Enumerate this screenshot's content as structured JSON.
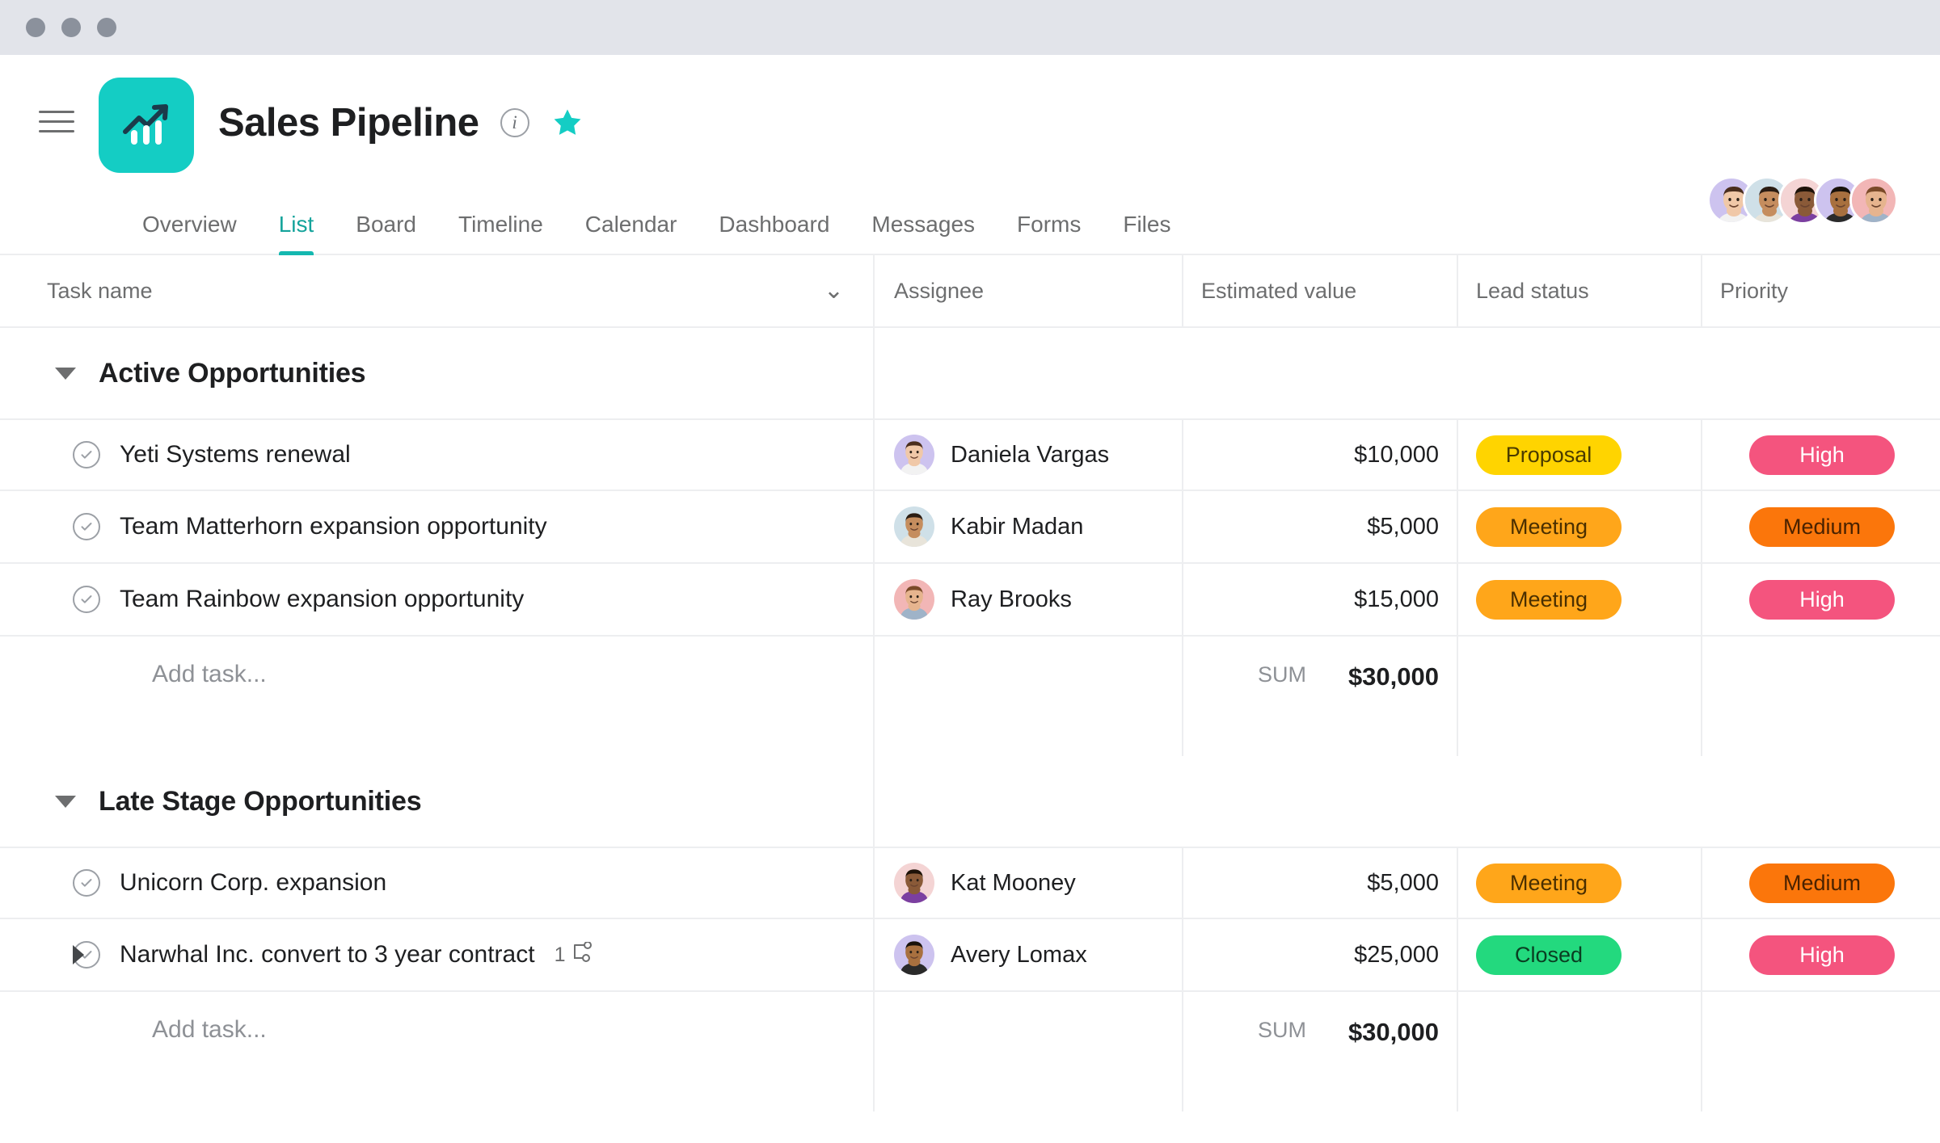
{
  "window": {
    "dots": [
      "close",
      "minimize",
      "maximize"
    ]
  },
  "header": {
    "menu_icon": "hamburger-icon",
    "logo_icon": "chart-growth-icon",
    "logo_color": "#14cdc4",
    "title": "Sales Pipeline",
    "info_icon": "info-icon",
    "star_icon": "star-icon",
    "star_color": "#14cdc4",
    "members": [
      {
        "name": "Daniela Vargas",
        "bg": "#cdc3ef",
        "skin": "#f0c8a8",
        "hair": "#4a2e1e",
        "top": "#f2f2f2"
      },
      {
        "name": "Kabir Madan",
        "bg": "#cfe0e8",
        "skin": "#c58d5e",
        "hair": "#2b1d13",
        "top": "#e8e4da"
      },
      {
        "name": "Kat Mooney",
        "bg": "#f4d4d4",
        "skin": "#8a5a38",
        "hair": "#1d1208",
        "top": "#7b3fa0"
      },
      {
        "name": "Avery Lomax",
        "bg": "#cdc3ef",
        "skin": "#a8703f",
        "hair": "#19120b",
        "top": "#2a2a2a"
      },
      {
        "name": "Ray Brooks",
        "bg": "#f2b6b6",
        "skin": "#e6b48e",
        "hair": "#7a4a28",
        "top": "#9fb3c8"
      }
    ]
  },
  "tabs": [
    {
      "label": "Overview",
      "active": false
    },
    {
      "label": "List",
      "active": true
    },
    {
      "label": "Board",
      "active": false
    },
    {
      "label": "Timeline",
      "active": false
    },
    {
      "label": "Calendar",
      "active": false
    },
    {
      "label": "Dashboard",
      "active": false
    },
    {
      "label": "Messages",
      "active": false
    },
    {
      "label": "Forms",
      "active": false
    },
    {
      "label": "Files",
      "active": false
    }
  ],
  "table": {
    "columns": {
      "task_name": "Task name",
      "assignee": "Assignee",
      "estimated_value": "Estimated value",
      "lead_status": "Lead status",
      "priority": "Priority"
    },
    "sum_label": "SUM",
    "add_task_label": "Add task...",
    "sections": [
      {
        "title": "Active Opportunities",
        "expanded": true,
        "sum": "$30,000",
        "tasks": [
          {
            "name": "Yeti Systems renewal",
            "assignee": "Daniela Vargas",
            "avatar": {
              "bg": "#cdc3ef",
              "skin": "#f0c8a8",
              "hair": "#4a2e1e",
              "top": "#f2f2f2"
            },
            "value": "$10,000",
            "status": {
              "label": "Proposal",
              "bg": "#ffd400",
              "fg": "#4a3b00"
            },
            "priority": {
              "label": "High",
              "bg": "#f4547e",
              "fg": "#ffffff"
            },
            "has_subtasks": false,
            "subtask_count": null
          },
          {
            "name": "Team Matterhorn expansion opportunity",
            "assignee": "Kabir Madan",
            "avatar": {
              "bg": "#cfe0e8",
              "skin": "#c58d5e",
              "hair": "#2b1d13",
              "top": "#e8e4da"
            },
            "value": "$5,000",
            "status": {
              "label": "Meeting",
              "bg": "#ffa61a",
              "fg": "#4a2f00"
            },
            "priority": {
              "label": "Medium",
              "bg": "#fb760b",
              "fg": "#4a2200"
            },
            "has_subtasks": false,
            "subtask_count": null
          },
          {
            "name": "Team Rainbow expansion opportunity",
            "assignee": "Ray Brooks",
            "avatar": {
              "bg": "#f2b6b6",
              "skin": "#e6b48e",
              "hair": "#7a4a28",
              "top": "#9fb3c8"
            },
            "value": "$15,000",
            "status": {
              "label": "Meeting",
              "bg": "#ffa61a",
              "fg": "#4a2f00"
            },
            "priority": {
              "label": "High",
              "bg": "#f4547e",
              "fg": "#ffffff"
            },
            "has_subtasks": false,
            "subtask_count": null
          }
        ]
      },
      {
        "title": "Late Stage Opportunities",
        "expanded": true,
        "sum": "$30,000",
        "tasks": [
          {
            "name": "Unicorn Corp. expansion",
            "assignee": "Kat Mooney",
            "avatar": {
              "bg": "#f4d4d4",
              "skin": "#8a5a38",
              "hair": "#1d1208",
              "top": "#7b3fa0"
            },
            "value": "$5,000",
            "status": {
              "label": "Meeting",
              "bg": "#ffa61a",
              "fg": "#4a2f00"
            },
            "priority": {
              "label": "Medium",
              "bg": "#fb760b",
              "fg": "#4a2200"
            },
            "has_subtasks": false,
            "subtask_count": null
          },
          {
            "name": "Narwhal Inc. convert to 3 year contract",
            "assignee": "Avery Lomax",
            "avatar": {
              "bg": "#cdc3ef",
              "skin": "#a8703f",
              "hair": "#19120b",
              "top": "#2a2a2a"
            },
            "value": "$25,000",
            "status": {
              "label": "Closed",
              "bg": "#23d97e",
              "fg": "#0a3d21"
            },
            "priority": {
              "label": "High",
              "bg": "#f4547e",
              "fg": "#ffffff"
            },
            "has_subtasks": true,
            "subtask_count": "1"
          }
        ]
      }
    ]
  }
}
